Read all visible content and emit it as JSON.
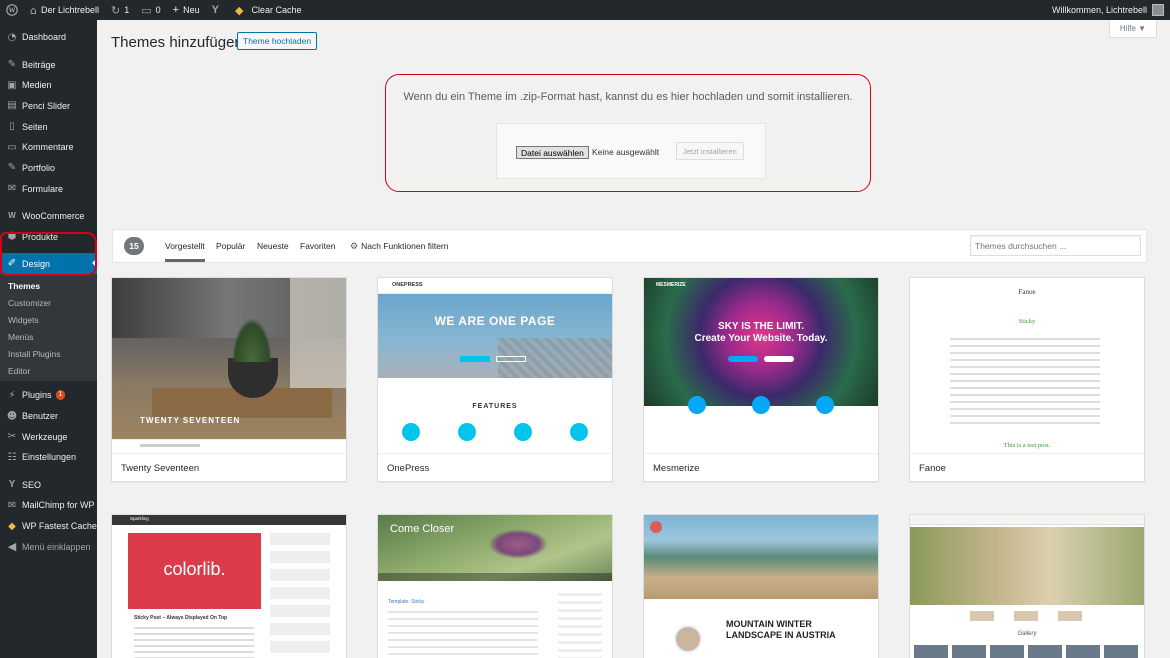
{
  "admin_bar": {
    "site_name": "Der Lichtrebell",
    "updates_count": "1",
    "comments_count": "0",
    "new_label": "Neu",
    "cache_label": "Clear Cache",
    "welcome": "Willkommen, Lichtrebell"
  },
  "sidebar": {
    "dashboard": "Dashboard",
    "posts": "Beiträge",
    "media": "Medien",
    "penci": "Penci Slider",
    "pages": "Seiten",
    "comments": "Kommentare",
    "portfolio": "Portfolio",
    "forms": "Formulare",
    "woocommerce": "WooCommerce",
    "products": "Produkte",
    "design": "Design",
    "design_sub": {
      "themes": "Themes",
      "customizer": "Customizer",
      "widgets": "Widgets",
      "menus": "Menüs",
      "install_plugins": "Install Plugins",
      "editor": "Editor"
    },
    "plugins": "Plugins",
    "plugins_badge": "1",
    "users": "Benutzer",
    "tools": "Werkzeuge",
    "settings": "Einstellungen",
    "seo": "SEO",
    "mailchimp": "MailChimp for WP",
    "fastest_cache": "WP Fastest Cache",
    "collapse": "Menü einklappen"
  },
  "header": {
    "title": "Themes hinzufügen",
    "upload_button": "Theme hochladen",
    "help": "Hilfe ▼"
  },
  "upload": {
    "message": "Wenn du ein Theme im .zip-Format hast, kannst du es hier hochladen und somit installieren.",
    "file_button": "Datei auswählen",
    "file_status": "Keine ausgewählt",
    "install_button": "Jetzt installieren"
  },
  "filter": {
    "count": "15",
    "tabs": [
      "Vorgestellt",
      "Populär",
      "Neueste",
      "Favoriten"
    ],
    "feature_filter": "Nach Funktionen filtern",
    "search_placeholder": "Themes durchsuchen ..."
  },
  "themes": [
    {
      "name": "Twenty Seventeen",
      "shot_text": "TWENTY SEVENTEEN"
    },
    {
      "name": "OnePress",
      "shot_text": "WE ARE ONE PAGE",
      "shot_sub": "FEATURES",
      "logo": "ONEPRESS"
    },
    {
      "name": "Mesmerize",
      "shot_text_1": "SKY IS THE LIMIT.",
      "shot_text_2": "Create Your Website. Today.",
      "logo": "MESMERIZE"
    },
    {
      "name": "Fanoe",
      "shot_title": "Fanoe",
      "shot_post": "Sticky",
      "shot_footer": "This is a test post."
    },
    {
      "name": "",
      "shot_text": "colorlib.",
      "shot_post": "Sticky Post – Always Displayed On Top",
      "logo": "Sparkling"
    },
    {
      "name": "",
      "shot_text": "Come Closer",
      "shot_post": "Template: Sticky"
    },
    {
      "name": "",
      "shot_text": "MOUNTAIN WINTER LANDSCAPE IN AUSTRIA"
    },
    {
      "name": "",
      "shot_text": "Gallery"
    }
  ]
}
